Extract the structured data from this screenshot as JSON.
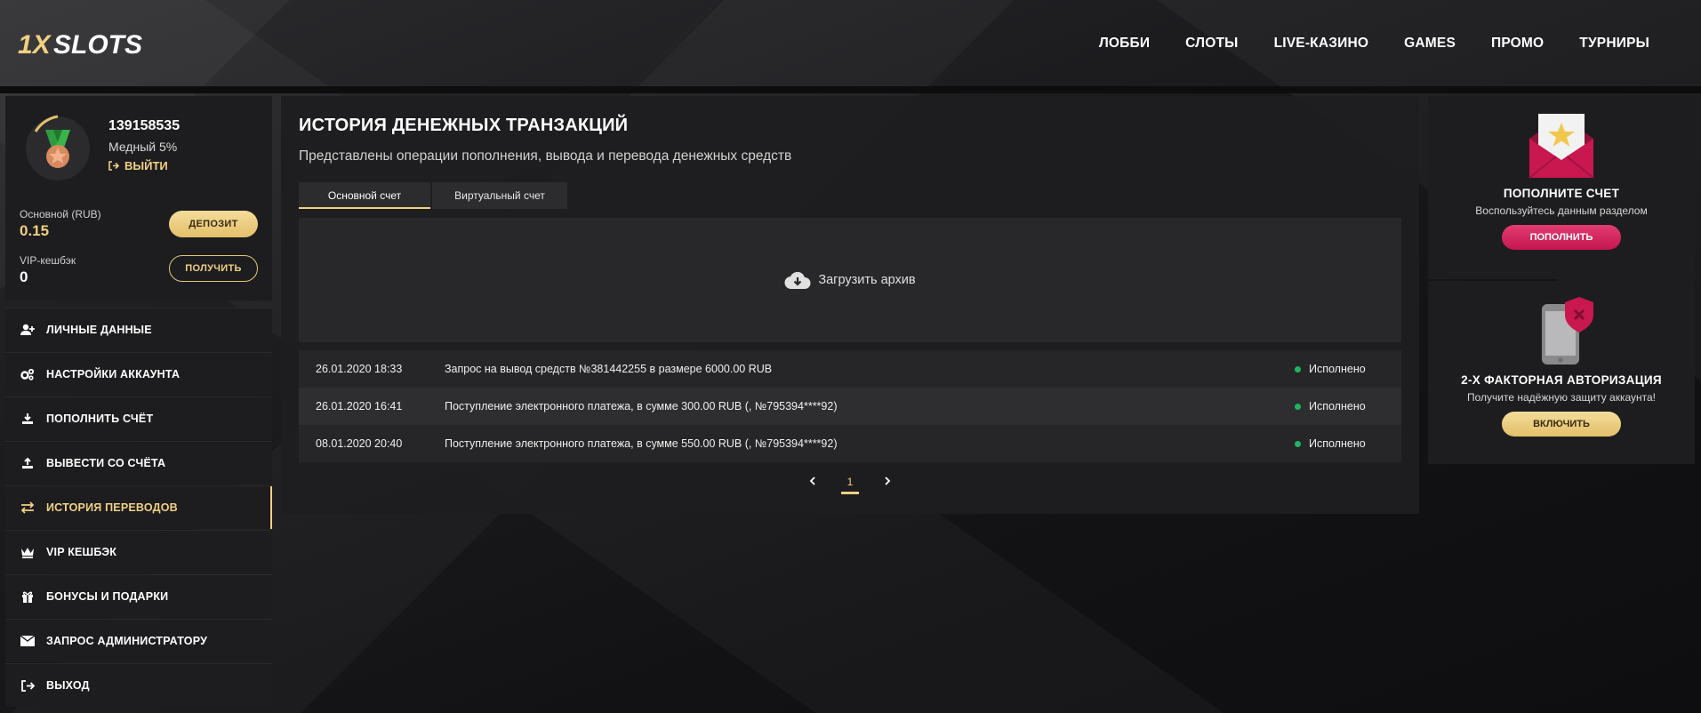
{
  "header": {
    "logo_text": "1XSLOTS",
    "nav": [
      "ЛОББИ",
      "СЛОТЫ",
      "LIVE-КАЗИНО",
      "GAMES",
      "ПРОМО",
      "ТУРНИРЫ"
    ]
  },
  "profile": {
    "user_id": "139158535",
    "level": "Медный 5%",
    "logout_label": "ВЫЙТИ",
    "balance_label": "Основной (RUB)",
    "balance_value": "0.15",
    "deposit_button": "ДЕПОЗИТ",
    "cashback_label": "VIP-кешбэк",
    "cashback_value": "0",
    "get_button": "ПОЛУЧИТЬ"
  },
  "menu": [
    {
      "label": "ЛИЧНЫЕ ДАННЫЕ",
      "icon": "user-plus-icon"
    },
    {
      "label": "НАСТРОЙКИ АККАУНТА",
      "icon": "gears-icon"
    },
    {
      "label": "ПОПОЛНИТЬ СЧЁТ",
      "icon": "download-icon"
    },
    {
      "label": "ВЫВЕСТИ СО СЧЁТА",
      "icon": "upload-icon"
    },
    {
      "label": "ИСТОРИЯ ПЕРЕВОДОВ",
      "icon": "transfer-icon",
      "active": true
    },
    {
      "label": "VIP КЕШБЭК",
      "icon": "crown-icon"
    },
    {
      "label": "БОНУСЫ И ПОДАРКИ",
      "icon": "gift-icon"
    },
    {
      "label": "ЗАПРОС АДМИНИСТРАТОРУ",
      "icon": "envelope-icon"
    },
    {
      "label": "ВЫХОД",
      "icon": "sign-out-icon"
    }
  ],
  "main": {
    "title": "ИСТОРИЯ ДЕНЕЖНЫХ ТРАНЗАКЦИЙ",
    "subtitle": "Представлены операции пополнения, вывода и перевода денежных средств",
    "tabs": [
      "Основной счет",
      "Виртуальный счет"
    ],
    "archive_label": "Загрузить архив",
    "transactions": [
      {
        "date": "26.01.2020 18:33",
        "description": "Запрос на вывод средств №381442255 в размере 6000.00 RUB",
        "status": "Исполнено"
      },
      {
        "date": "26.01.2020 16:41",
        "description": "Поступление электронного платежа, в сумме 300.00 RUB (, №795394****92)",
        "status": "Исполнено"
      },
      {
        "date": "08.01.2020 20:40",
        "description": "Поступление электронного платежа, в сумме 550.00 RUB (, №795394****92)",
        "status": "Исполнено"
      }
    ],
    "pagination": {
      "current": "1"
    }
  },
  "promos": [
    {
      "title": "ПОПОЛНИТЕ СЧЕТ",
      "text": "Воспользуйтесь данным разделом",
      "button": "ПОПОЛНИТЬ"
    },
    {
      "title": "2-Х ФАКТОРНАЯ АВТОРИЗАЦИЯ",
      "text": "Получите надёжную защиту аккаунта!",
      "button": "ВКЛЮЧИТЬ"
    }
  ],
  "colors": {
    "gold": "#f1d081",
    "pink": "#d4245d",
    "status_green": "#1fb461",
    "panel": "#1d1d1f"
  }
}
